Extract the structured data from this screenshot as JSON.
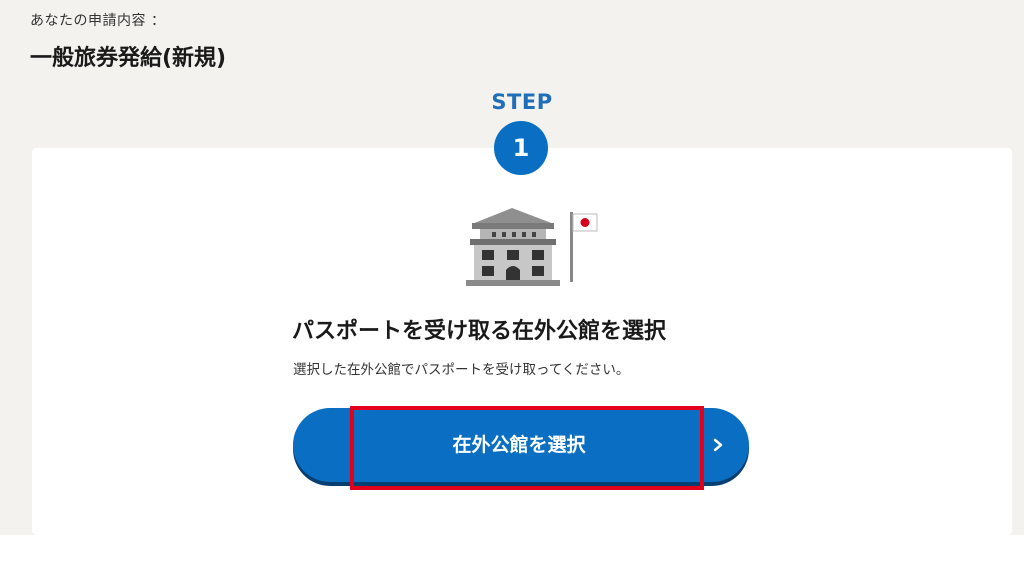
{
  "application": {
    "label": "あなたの申請内容 ：",
    "type": "一般旅券発給(新規)"
  },
  "step": {
    "label": "STEP",
    "number": "1"
  },
  "section": {
    "title": "パスポートを受け取る在外公館を選択",
    "description": "選択した在外公館でパスポートを受け取ってください。"
  },
  "select_button": {
    "label": "在外公館を選択",
    "icon": "chevron-right-icon"
  },
  "illustration": {
    "icon": "embassy-building-icon",
    "flag_icon": "japan-flag-icon"
  },
  "colors": {
    "primary": "#0a6fc2",
    "step_text": "#1f6fb8",
    "highlight": "#e3001b",
    "background": "#f3f2ef",
    "card": "#ffffff"
  }
}
